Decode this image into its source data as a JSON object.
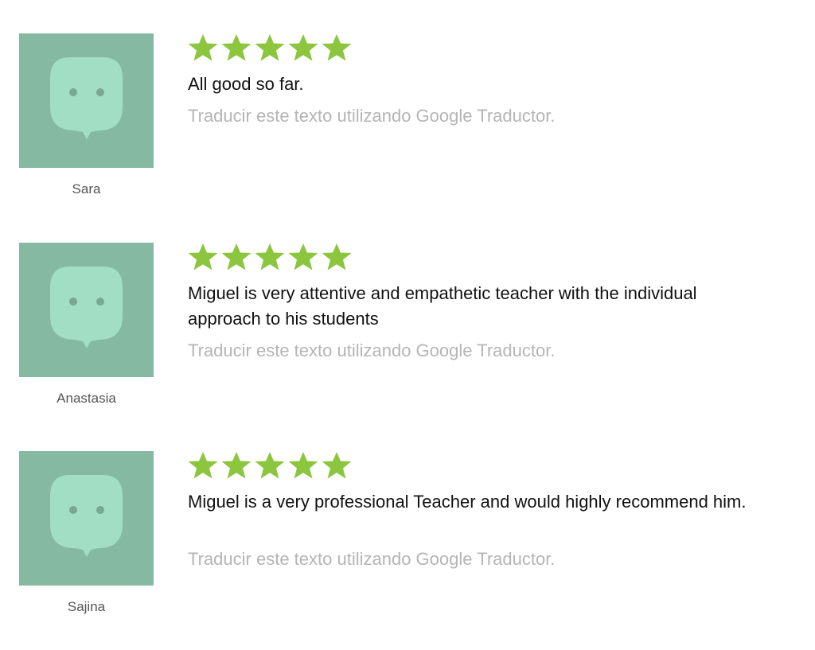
{
  "colors": {
    "star": "#8cc63f",
    "avatar_background": "#85b9a2",
    "avatar_bubble": "#a1dec4",
    "avatar_eyes": "#78a891",
    "comment_text": "#111111",
    "translate_text": "#b5b5b5",
    "name_text": "#555555"
  },
  "icons": {
    "avatar": "chat-bubble-face-avatar",
    "star": "star-filled"
  },
  "reviews": [
    {
      "name": "Sara",
      "rating": 5,
      "comment": "All good so far.",
      "translate_label": "Traducir este texto utilizando Google Traductor."
    },
    {
      "name": "Anastasia",
      "rating": 5,
      "comment": "Miguel is very attentive and empathetic teacher with the individual approach to his students",
      "translate_label": "Traducir este texto utilizando Google Traductor."
    },
    {
      "name": "Sajina",
      "rating": 5,
      "comment": "Miguel is a very professional Teacher and would highly recommend him.",
      "translate_label": "Traducir este texto utilizando Google Traductor."
    }
  ]
}
